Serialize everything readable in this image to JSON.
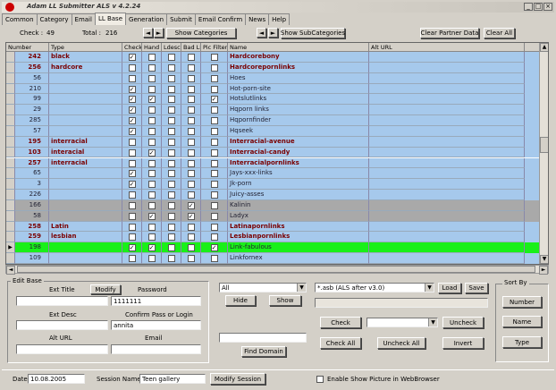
{
  "window": {
    "title": "Adam LL Submitter  ALS v 4.2.24",
    "minimize": "_",
    "maximize": "□",
    "close": "×"
  },
  "tabs": [
    "Common",
    "Category",
    "Email",
    "LL Base",
    "Generation",
    "Submit",
    "Email Confirm",
    "News",
    "Help"
  ],
  "toolbar": {
    "check_label": "Check :",
    "check_value": "49",
    "total_label": "Total :",
    "total_value": "216",
    "show_categories": "Show Categories",
    "show_subcategories": "Show SubCategories",
    "clear_partner": "Clear Partner Data",
    "clear_all": "Clear All",
    "prev": "◄",
    "next": "►"
  },
  "grid": {
    "columns": [
      "Number",
      "Type",
      "Check",
      "Hand",
      "Ldesc",
      "Bad LL",
      "Pic Filter",
      "Name",
      "Alt URL"
    ],
    "rows": [
      {
        "num": "242",
        "type": "black",
        "name": "Hardcorebony",
        "bold": true,
        "c": [
          1,
          0,
          0,
          0,
          0
        ],
        "style": "blue"
      },
      {
        "num": "256",
        "type": "hardcore",
        "name": "Hardcorepornlinks",
        "bold": true,
        "c": [
          0,
          0,
          0,
          0,
          0
        ],
        "style": "blue"
      },
      {
        "num": "56",
        "type": "",
        "name": "Hoes",
        "bold": false,
        "c": [
          0,
          0,
          0,
          0,
          0
        ],
        "style": "blue"
      },
      {
        "num": "210",
        "type": "",
        "name": "Hot-porn-site",
        "bold": false,
        "c": [
          1,
          0,
          0,
          0,
          0
        ],
        "style": "blue"
      },
      {
        "num": "99",
        "type": "",
        "name": "Hotslutlinks",
        "bold": false,
        "c": [
          1,
          1,
          0,
          0,
          1
        ],
        "style": "blue"
      },
      {
        "num": "29",
        "type": "",
        "name": "Hqporn links",
        "bold": false,
        "c": [
          1,
          0,
          0,
          0,
          0
        ],
        "style": "blue"
      },
      {
        "num": "285",
        "type": "",
        "name": "Hqpornfinder",
        "bold": false,
        "c": [
          1,
          0,
          0,
          0,
          0
        ],
        "style": "blue"
      },
      {
        "num": "57",
        "type": "",
        "name": "Hqseek",
        "bold": false,
        "c": [
          1,
          0,
          0,
          0,
          0
        ],
        "style": "blue"
      },
      {
        "num": "195",
        "type": "interracial",
        "name": "Interracial-avenue",
        "bold": true,
        "c": [
          0,
          0,
          0,
          0,
          0
        ],
        "style": "blue"
      },
      {
        "num": "103",
        "type": "interacial",
        "name": "Interracial-candy",
        "bold": true,
        "c": [
          0,
          1,
          0,
          0,
          0
        ],
        "style": "blue"
      },
      {
        "num": "257",
        "type": "interracial",
        "name": "Interracialpornlinks",
        "bold": true,
        "c": [
          0,
          0,
          0,
          0,
          0
        ],
        "style": "blue"
      },
      {
        "num": "65",
        "type": "",
        "name": "Jays-xxx-links",
        "bold": false,
        "c": [
          1,
          0,
          0,
          0,
          0
        ],
        "style": "blue"
      },
      {
        "num": "3",
        "type": "",
        "name": "Jk-porn",
        "bold": false,
        "c": [
          1,
          0,
          0,
          0,
          0
        ],
        "style": "blue"
      },
      {
        "num": "226",
        "type": "",
        "name": "Juicy-asses",
        "bold": false,
        "c": [
          0,
          0,
          0,
          0,
          0
        ],
        "style": "blue"
      },
      {
        "num": "166",
        "type": "",
        "name": "Kalinin",
        "bold": false,
        "c": [
          0,
          0,
          0,
          1,
          0
        ],
        "style": "gray"
      },
      {
        "num": "58",
        "type": "",
        "name": "Ladyx",
        "bold": false,
        "c": [
          0,
          1,
          0,
          1,
          0
        ],
        "style": "gray"
      },
      {
        "num": "258",
        "type": "Latin",
        "name": "Latinapornlinks",
        "bold": true,
        "c": [
          0,
          0,
          0,
          0,
          0
        ],
        "style": "blue"
      },
      {
        "num": "259",
        "type": "lesbian",
        "name": "Lesbianpornlinks",
        "bold": true,
        "c": [
          0,
          0,
          0,
          0,
          0
        ],
        "style": "blue"
      },
      {
        "num": "198",
        "type": "",
        "name": "Link-fabulous",
        "bold": false,
        "c": [
          1,
          1,
          0,
          0,
          1
        ],
        "style": "green",
        "current": true
      },
      {
        "num": "109",
        "type": "",
        "name": "Linkfornex",
        "bold": false,
        "c": [
          0,
          0,
          0,
          0,
          0
        ],
        "style": "blue"
      }
    ]
  },
  "edit_base": {
    "group_label": "Edit Base",
    "ext_title_label": "Ext Title",
    "modify_label": "Modify",
    "password_label": "Password",
    "password_value": "1111111",
    "ext_desc_label": "Ext Desc",
    "confirm_label": "Confirm Pass or Login",
    "confirm_value": "annita",
    "alt_url_label": "Alt URL",
    "email_label": "Email"
  },
  "filters": {
    "filter_value": "All",
    "hide_label": "Hide",
    "show_label": "Show",
    "find_domain_label": "Find Domain",
    "file_value": "*.asb (ALS after v3.0)",
    "load_label": "Load",
    "save_label": "Save"
  },
  "check_ops": {
    "check_label": "Check",
    "uncheck_label": "Uncheck",
    "check_all_label": "Check All",
    "uncheck_all_label": "Uncheck All",
    "invert_label": "Invert"
  },
  "sort": {
    "group_label": "Sort By",
    "number": "Number",
    "name": "Name",
    "type": "Type"
  },
  "status": {
    "date_label": "Date",
    "date_value": "10.08.2005",
    "session_label": "Session Name",
    "session_value": "Teen gallery",
    "modify_session": "Modify Session",
    "enable_pic": "Enable Show Picture in WebBrowser"
  }
}
